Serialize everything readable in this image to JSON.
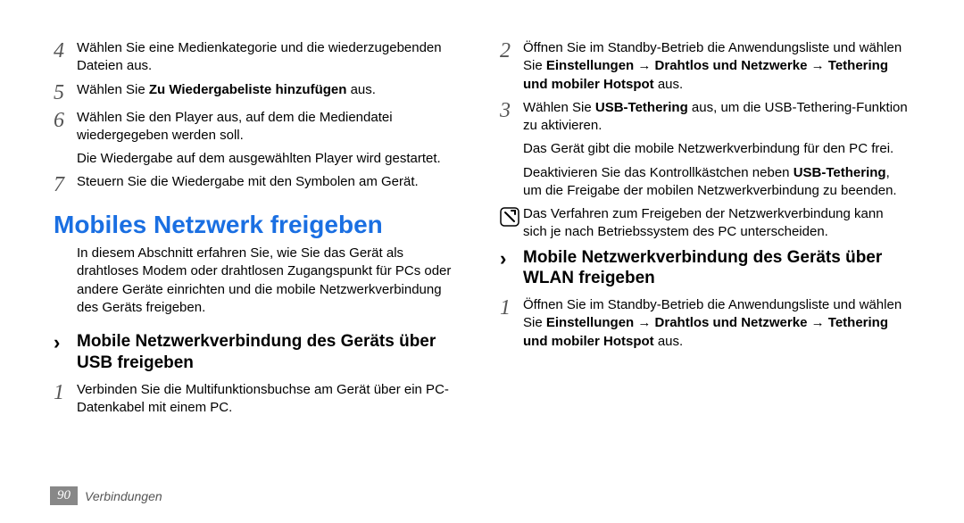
{
  "col1": {
    "steps_a": {
      "s4": {
        "num": "4",
        "text_a": "Wählen Sie eine Medienkategorie und die wiederzugebenden Dateien aus."
      },
      "s5": {
        "num": "5",
        "pre": "Wählen Sie ",
        "bold": "Zu Wiedergabeliste hinzufügen",
        "post": " aus."
      },
      "s6": {
        "num": "6",
        "text_a": "Wählen Sie den Player aus, auf dem die Mediendatei wiedergegeben werden soll.",
        "text_b": "Die Wiedergabe auf dem ausgewählten Player wird gestartet."
      },
      "s7": {
        "num": "7",
        "text_a": "Steuern Sie die Wiedergabe mit den Symbolen am Gerät."
      }
    },
    "section_title": "Mobiles Netzwerk freigeben",
    "intro": "In diesem Abschnitt erfahren Sie, wie Sie das Gerät als drahtloses Modem oder drahtlosen Zugangspunkt für PCs oder andere Geräte einrichten und die mobile Netzwerkverbindung des Geräts freigeben.",
    "sub_marker": "›",
    "sub_title": "Mobile Netzwerkverbindung des Geräts über USB freigeben",
    "steps_b": {
      "s1": {
        "num": "1",
        "text_a": "Verbinden Sie die Multifunktionsbuchse am Gerät über ein PC-Datenkabel mit einem PC."
      }
    }
  },
  "col2": {
    "steps_a": {
      "s2": {
        "num": "2",
        "pre": "Öffnen Sie im Standby-Betrieb die Anwendungsliste und wählen Sie ",
        "b1": "Einstellungen",
        "arrow1": " → ",
        "b2": "Drahtlos und Netzwerke",
        "arrow2": " → ",
        "b3": "Tethering und mobiler Hotspot",
        "post": " aus."
      },
      "s3": {
        "num": "3",
        "pre": "Wählen Sie ",
        "b1": "USB-Tethering",
        "post": " aus, um die USB-Tethering-Funktion zu aktivieren.",
        "text_b": "Das Gerät gibt die mobile Netzwerkverbindung für den PC frei.",
        "text_c_pre": "Deaktivieren Sie das Kontrollkästchen neben ",
        "text_c_b": "USB-Tethering",
        "text_c_post": ", um die Freigabe der mobilen Netzwerkverbindung zu beenden."
      }
    },
    "note": "Das Verfahren zum Freigeben der Netzwerkverbindung kann sich je nach Betriebssystem des PC unterscheiden.",
    "sub_marker": "›",
    "sub_title": "Mobile Netzwerkverbindung des Geräts über WLAN freigeben",
    "steps_b": {
      "s1": {
        "num": "1",
        "pre": "Öffnen Sie im Standby-Betrieb die Anwendungsliste und wählen Sie ",
        "b1": "Einstellungen",
        "arrow1": " → ",
        "b2": "Drahtlos und Netzwerke",
        "arrow2": " → ",
        "b3": "Tethering und mobiler Hotspot",
        "post": " aus."
      }
    }
  },
  "footer": {
    "page": "90",
    "label": "Verbindungen"
  }
}
